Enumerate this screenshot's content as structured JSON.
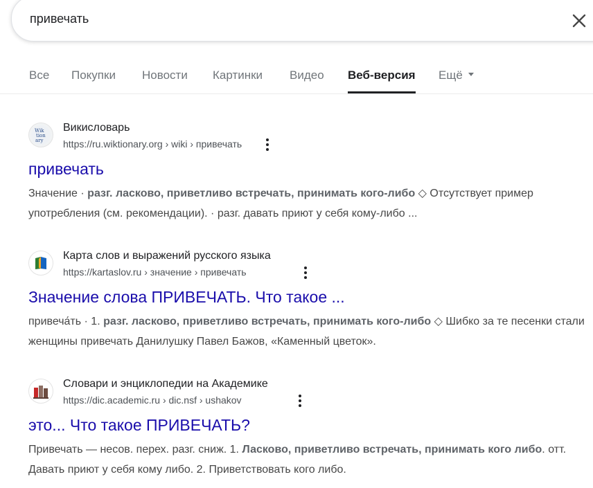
{
  "search": {
    "query": "привечать"
  },
  "tabs": [
    {
      "label": "Все"
    },
    {
      "label": "Покупки"
    },
    {
      "label": "Новости"
    },
    {
      "label": "Картинки"
    },
    {
      "label": "Видео"
    },
    {
      "label": "Веб-версия",
      "active": true
    },
    {
      "label": "Ещё"
    }
  ],
  "results": [
    {
      "site_name": "Викисловарь",
      "url": "https://ru.wiktionary.org › wiki › привечать",
      "title": "привечать",
      "favicon": "wiktionary-icon",
      "snippet_parts": [
        {
          "text": "Значение · ",
          "bold": false
        },
        {
          "text": "разг. ласково, приветливо встречать, принимать кого-либо",
          "bold": true
        },
        {
          "text": " ◇ Отсутствует пример употребления (см. рекомендации). · разг. давать приют у себя кому-либо ...",
          "bold": false
        }
      ]
    },
    {
      "site_name": "Карта слов и выражений русского языка",
      "url": "https://kartaslov.ru › значение › привечать",
      "title": "Значение слова ПРИВЕЧАТЬ. Что такое ...",
      "favicon": "book-icon",
      "snippet_parts": [
        {
          "text": "привеча́ть · 1. ",
          "bold": false
        },
        {
          "text": "разг. ласково, приветливо встречать, принимать кого-либо",
          "bold": true
        },
        {
          "text": " ◇ Шибко за те песенки стали женщины привечать Данилушку Павел Бажов, «Каменный цветок».",
          "bold": false
        }
      ]
    },
    {
      "site_name": "Словари и энциклопедии на Академике",
      "url": "https://dic.academic.ru › dic.nsf › ushakov",
      "title": "это... Что такое ПРИВЕЧАТЬ?",
      "favicon": "books-icon",
      "snippet_parts": [
        {
          "text": "Привечать — несов. перех. разг. сниж. 1. ",
          "bold": false
        },
        {
          "text": "Ласково, приветливо встречать, принимать кого либо",
          "bold": true
        },
        {
          "text": ". отт. Давать приют у себя кому либо. 2. Приветствовать кого либо.",
          "bold": false
        }
      ]
    }
  ],
  "colors": {
    "link": "#1a0dab",
    "text": "#202124",
    "muted": "#4d5156"
  }
}
